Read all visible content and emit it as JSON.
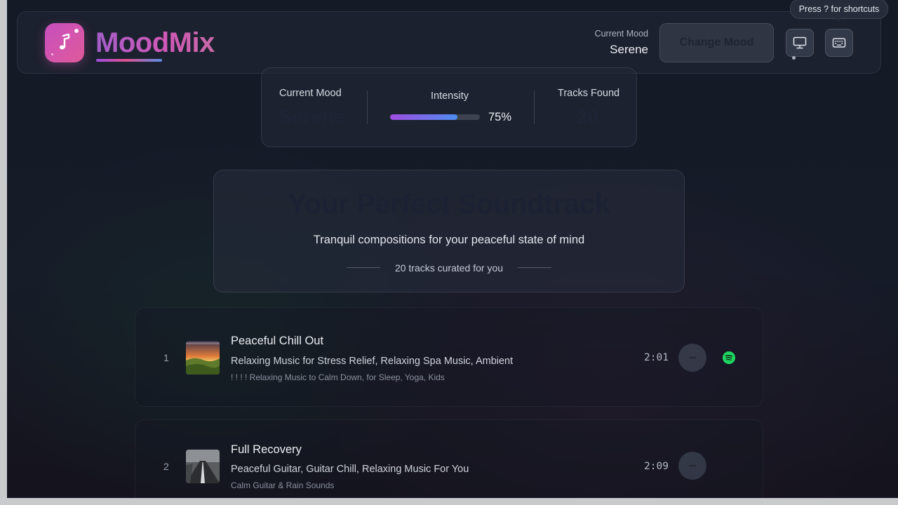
{
  "app": {
    "brand": "MoodMix"
  },
  "header": {
    "current_mood_label": "Current Mood",
    "current_mood_value": "Serene",
    "change_mood_label": "Change Mood",
    "display_icon": "monitor-icon",
    "keyboard_icon": "keyboard-icon"
  },
  "tooltip": {
    "text": "Press ? for shortcuts"
  },
  "stats": {
    "mood_label": "Current Mood",
    "mood_value": "Serene",
    "intensity_label": "Intensity",
    "intensity_percent": 75,
    "intensity_text": "75%",
    "tracks_label": "Tracks Found",
    "tracks_value": "20"
  },
  "hero": {
    "title": "Your Perfect Soundtrack",
    "subtitle": "Tranquil compositions for your peaceful state of mind",
    "count_text": "20 tracks curated for you"
  },
  "tracks": [
    {
      "number": "1",
      "title": "Peaceful Chill Out",
      "artists": "Relaxing Music for Stress Relief, Relaxing Spa Music, Ambient",
      "album": "! ! ! ! Relaxing Music to Calm Down, for Sleep, Yoga, Kids",
      "duration": "2:01",
      "has_spotify": true
    },
    {
      "number": "2",
      "title": "Full Recovery",
      "artists": "Peaceful Guitar, Guitar Chill, Relaxing Music For You",
      "album": "Calm Guitar & Rain Sounds",
      "duration": "2:09",
      "has_spotify": false
    }
  ],
  "colors": {
    "brand_gradient_start": "#a55dc9",
    "brand_gradient_end": "#d158b7",
    "intensity_start": "#a04de0",
    "intensity_end": "#4e8df0",
    "spotify_green": "#1ed760"
  }
}
